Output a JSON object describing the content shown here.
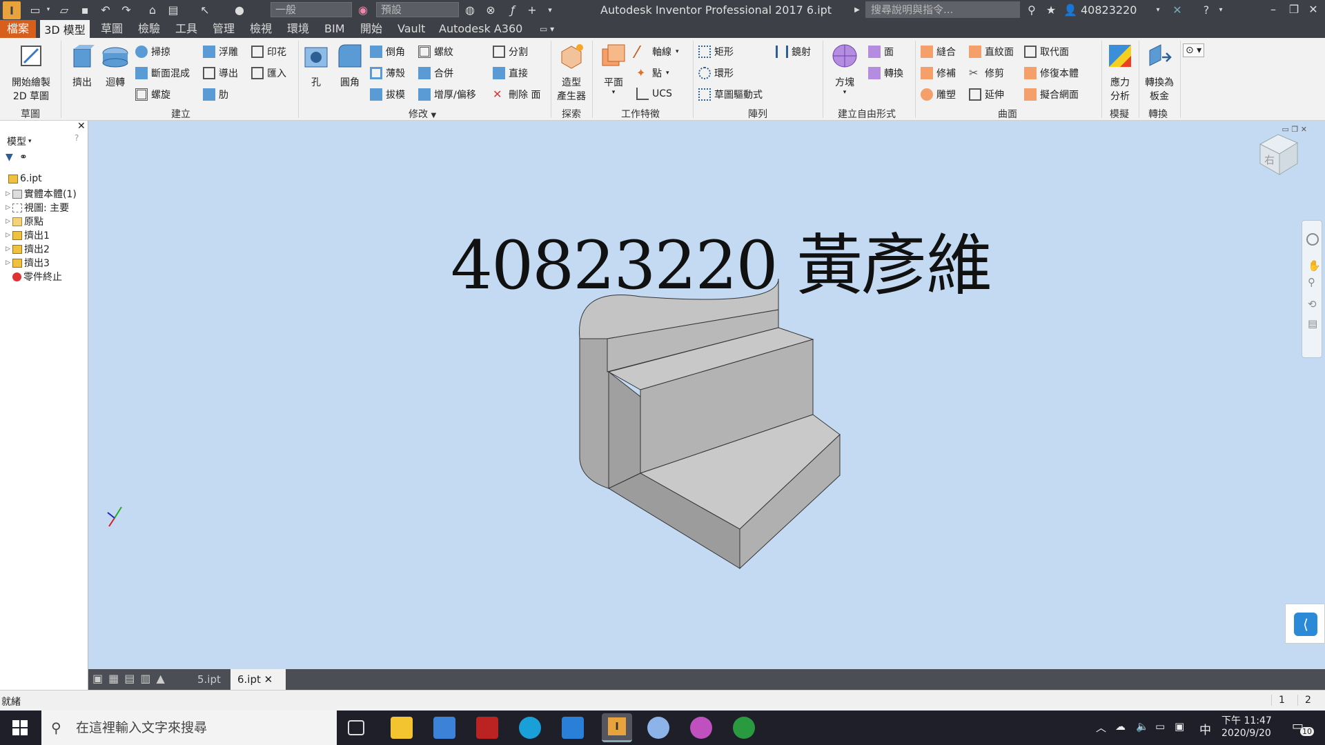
{
  "titlebar": {
    "appearance_select": "一般",
    "material_select": "預設",
    "title": "Autodesk Inventor Professional 2017    6.ipt",
    "search_placeholder": "搜尋說明與指令...",
    "user": "40823220"
  },
  "tabs": [
    "檔案",
    "3D 模型",
    "草圖",
    "檢驗",
    "工具",
    "管理",
    "檢視",
    "環境",
    "BIM",
    "開始",
    "Vault",
    "Autodesk A360"
  ],
  "ribbon": {
    "sketch": {
      "start_2d_line1": "開始繪製",
      "start_2d_line2": "2D 草圖",
      "label": "草圖"
    },
    "create": {
      "extrude": "擠出",
      "revolve": "迴轉",
      "sweep": "掃掠",
      "loft": "斷面混成",
      "coil": "螺旋",
      "emboss": "浮雕",
      "derive": "導出",
      "rib": "肋",
      "decal": "印花",
      "import": "匯入",
      "label": "建立"
    },
    "modify": {
      "hole": "孔",
      "fillet": "圓角",
      "chamfer": "倒角",
      "shell": "薄殼",
      "draft": "拔模",
      "thread": "螺紋",
      "combine": "合併",
      "thicken": "增厚/偏移",
      "split": "分割",
      "direct": "直接",
      "delete_face": "刪除 面",
      "label": "修改"
    },
    "explore": {
      "shape_gen_line1": "造型",
      "shape_gen_line2": "產生器",
      "label": "探索"
    },
    "work": {
      "plane": "平面",
      "axis": "軸線",
      "point": "點",
      "ucs": "UCS",
      "label": "工作特徵"
    },
    "pattern": {
      "rect": "矩形",
      "circ": "環形",
      "sketch_driven": "草圖驅動式",
      "mirror": "鏡射",
      "label": "陣列"
    },
    "freeform": {
      "box": "方塊",
      "face": "面",
      "convert": "轉換",
      "label": "建立自由形式"
    },
    "surface": {
      "stitch": "縫合",
      "patch": "修補",
      "sculpt": "雕塑",
      "ruled": "直紋面",
      "trim": "修剪",
      "extend": "延伸",
      "replace": "取代面",
      "repair": "修復本體",
      "fit_mesh": "擬合網面",
      "label": "曲面"
    },
    "simulation": {
      "stress_line1": "應力",
      "stress_line2": "分析",
      "label": "模擬"
    },
    "convert": {
      "sheetmetal_line1": "轉換為",
      "sheetmetal_line2": "板金",
      "label": "轉換"
    }
  },
  "browser": {
    "header": "模型",
    "nodes": [
      {
        "label": "6.ipt"
      },
      {
        "label": "實體本體(1)"
      },
      {
        "label": "視圖: 主要"
      },
      {
        "label": "原點"
      },
      {
        "label": "擠出1"
      },
      {
        "label": "擠出2"
      },
      {
        "label": "擠出3"
      },
      {
        "label": "零件終止"
      }
    ]
  },
  "viewport": {
    "overlay_text": "40823220 黃彥維",
    "view_cube": "右"
  },
  "doc_tabs": [
    "5.ipt",
    "6.ipt"
  ],
  "statusbar": {
    "status": "就緒",
    "count1": "1",
    "count2": "2"
  },
  "taskbar": {
    "search_placeholder": "在這裡輸入文字來搜尋",
    "time": "下午 11:47",
    "date": "2020/9/20",
    "ime": "中",
    "notifications": "10"
  }
}
